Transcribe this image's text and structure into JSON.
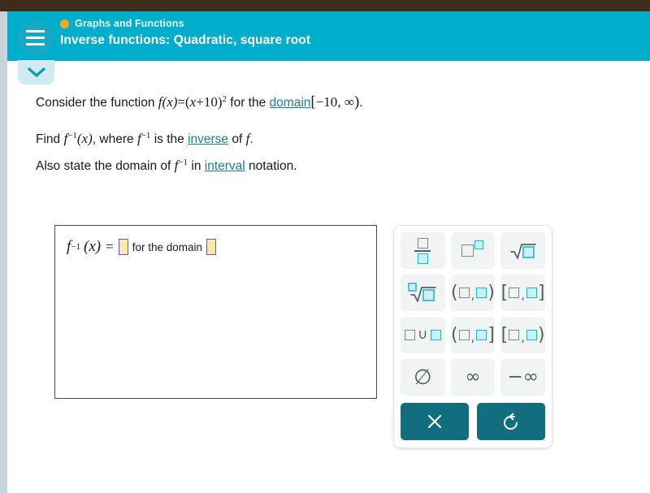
{
  "window": {
    "top_strip_color": "#3d2b1c",
    "header_color": "#00aecb",
    "accent_teal": "#126e7e",
    "link_color": "#1a7f93",
    "input_fill": "#fbe7a6",
    "input_border": "#5b5bd6",
    "cyan_slot": "#1fb6d4",
    "gray_slot": "#7b8a90",
    "breadcrumb_dot_color": "#f5a623"
  },
  "header": {
    "menu_icon": "hamburger-icon",
    "breadcrumb": "Graphs and Functions",
    "title": "Inverse functions: Quadratic, square root",
    "collapse_icon": "chevron-down-icon"
  },
  "problem": {
    "line1": {
      "prefix": "Consider the function ",
      "fn": "f",
      "arg": "(x)",
      "equals": "=",
      "expr_open": "(",
      "expr_var": "x",
      "expr_plus": "+",
      "expr_num": "10",
      "expr_close": ")",
      "expr_pow": "2",
      "mid": " for the ",
      "link": "domain",
      "interval_open": "[",
      "interval_a": "−10",
      "interval_comma": ", ",
      "interval_b": "∞",
      "interval_close": ")",
      "period": "."
    },
    "line2": {
      "find": "Find ",
      "fn": "f",
      "inv": "−1",
      "arg": "(x)",
      "comma_where": ", where ",
      "fn2": "f",
      "inv2": "−1",
      "isthe": " is the ",
      "link": "inverse",
      "of": " of ",
      "fn3": "f",
      "period": "."
    },
    "line3": {
      "prefix": "Also state the domain of ",
      "fn": "f",
      "inv": "−1",
      "mid": " in ",
      "link": "interval",
      "suffix": " notation."
    }
  },
  "answer": {
    "fn": "f",
    "inv": "−1",
    "arg": "(x)",
    "equals": "=",
    "input1_value": "",
    "middle_label": "for the domain",
    "input2_value": "",
    "input_placeholder": ""
  },
  "keypad": {
    "buttons": [
      {
        "name": "fraction-button",
        "label": "fraction",
        "glyph": "□/□"
      },
      {
        "name": "power-button",
        "label": "power",
        "glyph": "□^□"
      },
      {
        "name": "square-root-button",
        "label": "square root",
        "glyph": "√□"
      },
      {
        "name": "nth-root-button",
        "label": "nth root",
        "glyph": "ⁿ√□"
      },
      {
        "name": "open-interval-button",
        "label": "open interval",
        "glyph": "(□,□)"
      },
      {
        "name": "closed-interval-button",
        "label": "closed interval",
        "glyph": "[□,□]"
      },
      {
        "name": "union-button",
        "label": "union",
        "glyph": "□∪□"
      },
      {
        "name": "half-open-right-button",
        "label": "half-open interval right closed",
        "glyph": "(□,□]"
      },
      {
        "name": "half-open-left-button",
        "label": "half-open interval left closed",
        "glyph": "[□,□)"
      },
      {
        "name": "empty-set-button",
        "label": "empty set",
        "glyph": "∅"
      },
      {
        "name": "infinity-button",
        "label": "infinity",
        "glyph": "∞"
      },
      {
        "name": "negative-infinity-button",
        "label": "negative infinity",
        "glyph": "−∞"
      }
    ],
    "actions": [
      {
        "name": "clear-button",
        "label": "clear",
        "glyph": "×"
      },
      {
        "name": "undo-button",
        "label": "undo",
        "glyph": "↺"
      }
    ]
  }
}
